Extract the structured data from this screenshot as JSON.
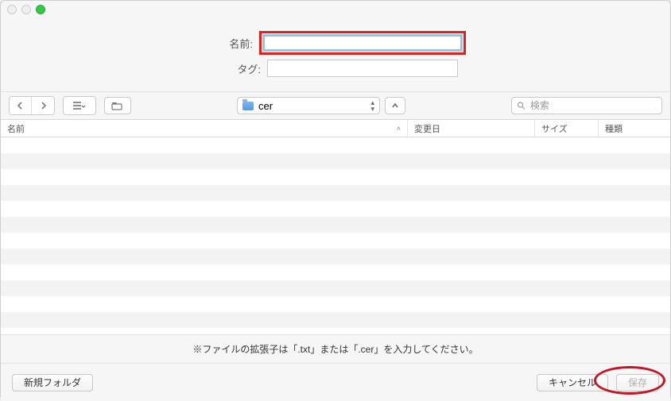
{
  "form": {
    "name_label": "名前:",
    "name_value": "",
    "tag_label": "タグ:",
    "tag_value": ""
  },
  "toolbar": {
    "folder_name": "cer",
    "search_placeholder": "検索"
  },
  "columns": {
    "name": "名前",
    "date": "変更日",
    "size": "サイズ",
    "kind": "種類"
  },
  "hint": "※ファイルの拡張子は「.txt」または「.cer」を入力してください。",
  "footer": {
    "new_folder": "新規フォルダ",
    "cancel": "キャンセル",
    "save": "保存"
  }
}
